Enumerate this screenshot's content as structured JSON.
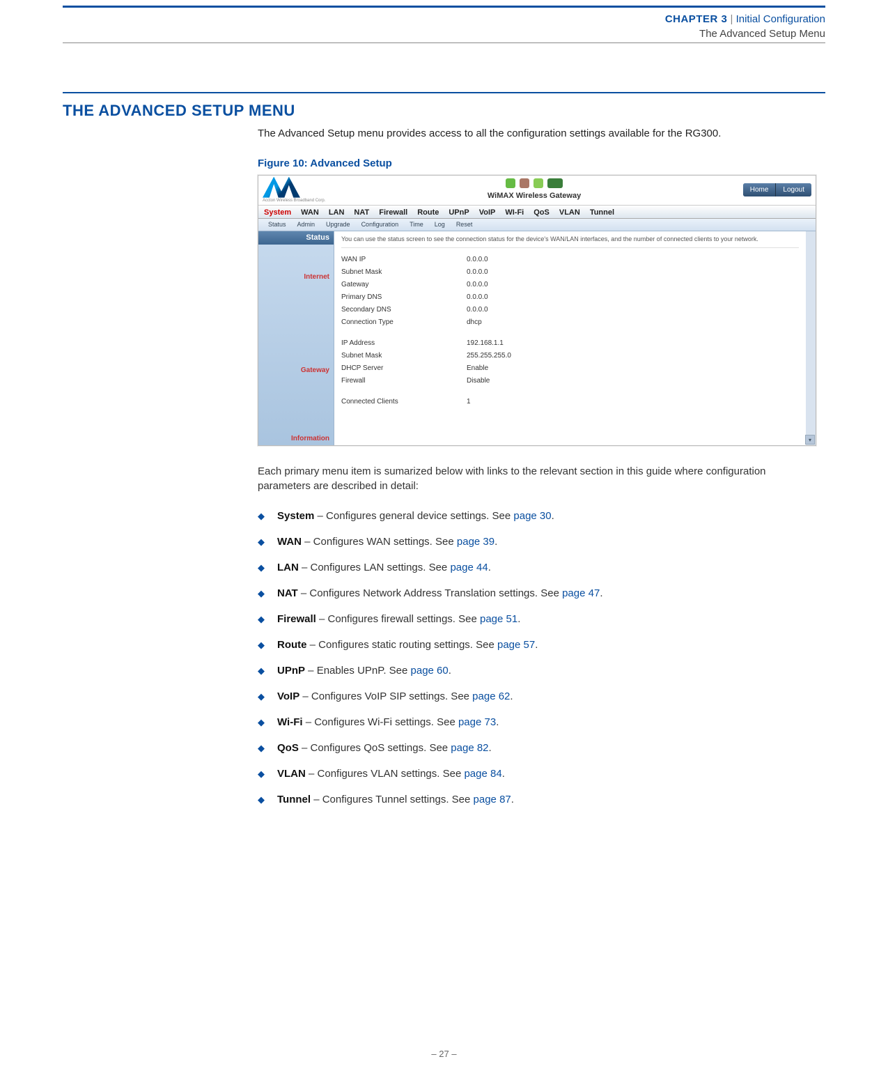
{
  "header": {
    "chapter_label": "CHAPTER 3",
    "separator": "|",
    "chapter_title": "Initial Configuration",
    "subtitle": "The Advanced Setup Menu"
  },
  "section": {
    "heading": "THE ADVANCED SETUP MENU",
    "intro": "The Advanced Setup menu provides access to all the configuration settings available for the RG300.",
    "figure_caption": "Figure 10:  Advanced Setup"
  },
  "screenshot": {
    "logo_sub": "Accton Wireless Broadband Corp.",
    "title": "WiMAX Wireless Gateway",
    "buttons": {
      "home": "Home",
      "logout": "Logout"
    },
    "main_tabs": [
      "System",
      "WAN",
      "LAN",
      "NAT",
      "Firewall",
      "Route",
      "UPnP",
      "VoIP",
      "WI-Fi",
      "QoS",
      "VLAN",
      "Tunnel"
    ],
    "sub_tabs": [
      "Status",
      "Admin",
      "Upgrade",
      "Configuration",
      "Time",
      "Log",
      "Reset"
    ],
    "sidebar": {
      "title": "Status",
      "sec1": "Internet",
      "sec2": "Gateway",
      "sec3": "Information"
    },
    "hint": "You can use the status screen to see the connection status for the device's WAN/LAN interfaces, and the number of connected clients to your network.",
    "internet": [
      {
        "k": "WAN IP",
        "v": "0.0.0.0"
      },
      {
        "k": "Subnet Mask",
        "v": "0.0.0.0"
      },
      {
        "k": "Gateway",
        "v": "0.0.0.0"
      },
      {
        "k": "Primary DNS",
        "v": "0.0.0.0"
      },
      {
        "k": "Secondary DNS",
        "v": "0.0.0.0"
      },
      {
        "k": "Connection Type",
        "v": "dhcp"
      }
    ],
    "gateway": [
      {
        "k": "IP Address",
        "v": "192.168.1.1"
      },
      {
        "k": "Subnet Mask",
        "v": "255.255.255.0"
      },
      {
        "k": "DHCP Server",
        "v": "Enable"
      },
      {
        "k": "Firewall",
        "v": "Disable"
      }
    ],
    "information": [
      {
        "k": "Connected Clients",
        "v": "1"
      }
    ]
  },
  "after_figure": "Each primary menu item is sumarized below with links to the relevant section in this guide where configuration parameters are described in detail:",
  "menu_items": [
    {
      "name": "System",
      "desc": " – Configures general device settings. See ",
      "link": "page 30",
      "tail": "."
    },
    {
      "name": "WAN",
      "desc": " – Configures WAN settings. See ",
      "link": "page 39",
      "tail": "."
    },
    {
      "name": "LAN",
      "desc": " – Configures LAN settings. See ",
      "link": "page 44",
      "tail": "."
    },
    {
      "name": "NAT",
      "desc": " – Configures Network Address Translation settings. See ",
      "link": "page 47",
      "tail": "."
    },
    {
      "name": "Firewall",
      "desc": " – Configures firewall settings. See ",
      "link": "page 51",
      "tail": "."
    },
    {
      "name": "Route",
      "desc": " – Configures static routing settings. See ",
      "link": "page 57",
      "tail": "."
    },
    {
      "name": "UPnP",
      "desc": " – Enables UPnP. See ",
      "link": "page 60",
      "tail": "."
    },
    {
      "name": "VoIP",
      "desc": " – Configures VoIP SIP settings. See ",
      "link": "page 62",
      "tail": "."
    },
    {
      "name": "Wi-Fi",
      "desc": " – Configures Wi-Fi settings. See ",
      "link": "page 73",
      "tail": "."
    },
    {
      "name": "QoS",
      "desc": " – Configures QoS settings. See ",
      "link": "page 82",
      "tail": "."
    },
    {
      "name": "VLAN",
      "desc": " – Configures VLAN settings. See ",
      "link": "page 84",
      "tail": "."
    },
    {
      "name": "Tunnel",
      "desc": " – Configures Tunnel settings. See ",
      "link": "page 87",
      "tail": "."
    }
  ],
  "footer": {
    "page": "–  27  –"
  }
}
